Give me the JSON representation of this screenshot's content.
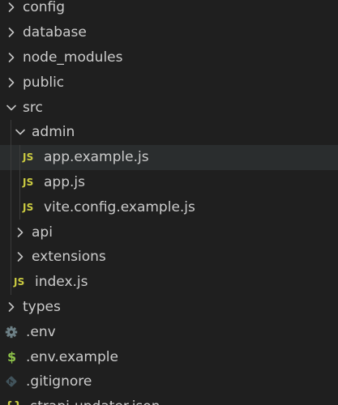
{
  "tree": {
    "items": [
      {
        "label": "config",
        "type": "folder",
        "expanded": false,
        "depth": 0
      },
      {
        "label": "database",
        "type": "folder",
        "expanded": false,
        "depth": 0
      },
      {
        "label": "node_modules",
        "type": "folder",
        "expanded": false,
        "depth": 0
      },
      {
        "label": "public",
        "type": "folder",
        "expanded": false,
        "depth": 0
      },
      {
        "label": "src",
        "type": "folder",
        "expanded": true,
        "depth": 0
      },
      {
        "label": "admin",
        "type": "folder",
        "expanded": true,
        "depth": 1
      },
      {
        "label": "app.example.js",
        "type": "file",
        "icon": "js",
        "icon_text": "JS",
        "depth": 2,
        "selected": true
      },
      {
        "label": "app.js",
        "type": "file",
        "icon": "js",
        "icon_text": "JS",
        "depth": 2
      },
      {
        "label": "vite.config.example.js",
        "type": "file",
        "icon": "js",
        "icon_text": "JS",
        "depth": 2
      },
      {
        "label": "api",
        "type": "folder",
        "expanded": false,
        "depth": 1
      },
      {
        "label": "extensions",
        "type": "folder",
        "expanded": false,
        "depth": 1
      },
      {
        "label": "index.js",
        "type": "file",
        "icon": "js",
        "icon_text": "JS",
        "depth": 1
      },
      {
        "label": "types",
        "type": "folder",
        "expanded": false,
        "depth": 0
      },
      {
        "label": ".env",
        "type": "file",
        "icon": "gear",
        "depth": 0
      },
      {
        "label": ".env.example",
        "type": "file",
        "icon": "dollar",
        "icon_text": "$",
        "depth": 0
      },
      {
        "label": ".gitignore",
        "type": "file",
        "icon": "git",
        "depth": 0
      },
      {
        "label": ".strapi-updater.json",
        "type": "file",
        "icon": "json",
        "icon_text": "{}",
        "depth": 0
      }
    ]
  },
  "colors": {
    "background": "#1f1f1f",
    "selected_row": "#2a2d2e",
    "text": "#cccccc",
    "js": "#cbcb41",
    "gear": "#6d8086",
    "dollar": "#8dc149",
    "git": "#41535b",
    "json": "#cbcb41",
    "guide": "#3b3b3b"
  }
}
